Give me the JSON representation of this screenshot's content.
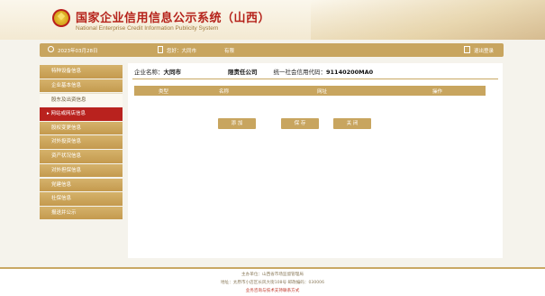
{
  "header": {
    "title_cn": "国家企业信用信息公示系统（山西）",
    "title_en": "National Enterprise Credit Information Publicity System"
  },
  "topbar": {
    "date": "2023年03月28日",
    "user_label": "您好：大同市",
    "greeting": "有限",
    "logout": "退出登录"
  },
  "sidebar": {
    "items": [
      {
        "label": "特种设备信息",
        "state": "normal"
      },
      {
        "label": "企业基本信息",
        "state": "normal"
      },
      {
        "label": "股东及出资信息",
        "state": "blank"
      },
      {
        "label": "网站或网店信息",
        "state": "active"
      },
      {
        "label": "股权变更信息",
        "state": "normal"
      },
      {
        "label": "对外投资信息",
        "state": "normal"
      },
      {
        "label": "资产状况信息",
        "state": "normal"
      },
      {
        "label": "对外担保信息",
        "state": "normal"
      },
      {
        "label": "党建信息",
        "state": "normal"
      },
      {
        "label": "社保信息",
        "state": "normal"
      },
      {
        "label": "报送并公示",
        "state": "normal"
      }
    ]
  },
  "company": {
    "name_label": "企业名称：",
    "name_prefix": "大同市",
    "name_suffix": "限责任公司",
    "code_label": "统一社会信用代码：",
    "code_value": "91140200MA0"
  },
  "table": {
    "headers": [
      "类型",
      "名称",
      "网址",
      "操作"
    ]
  },
  "buttons": {
    "add": "添 加",
    "save": "保 存",
    "close": "关 闭"
  },
  "footer": {
    "line1": "主办单位：山西省市场监督管理局",
    "line2": "地址：太原市小店区长风大街108号 邮政编码：030006",
    "line3": "业务咨询与技术支持联系方式"
  },
  "colors": {
    "accent": "#c8a55f",
    "active": "#b9221e",
    "title": "#b5221a"
  }
}
